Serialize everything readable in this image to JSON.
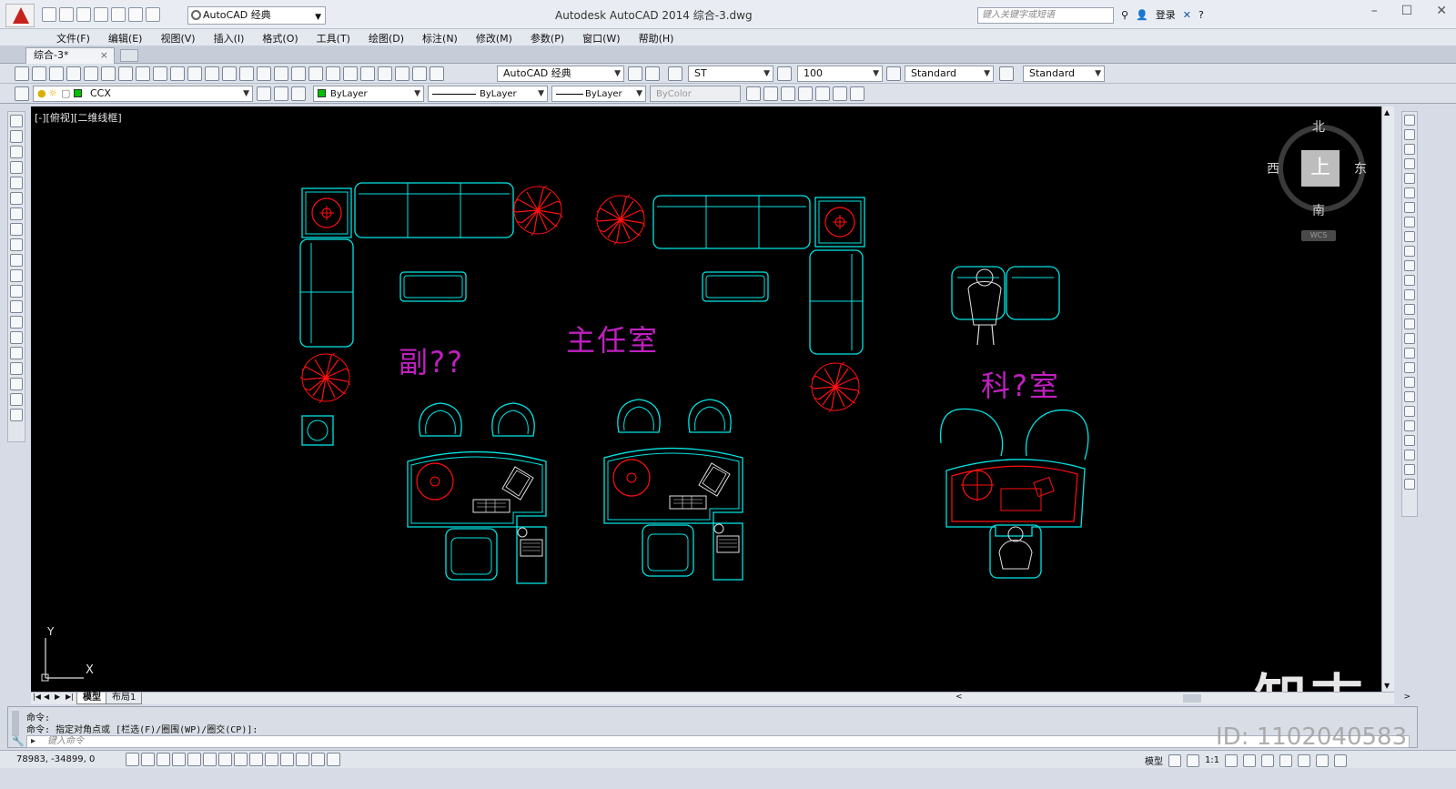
{
  "window": {
    "title": "Autodesk AutoCAD 2014      综合-3.dwg",
    "workspace": "AutoCAD 经典",
    "search_placeholder": "键入关键字或短语",
    "login": "登录"
  },
  "menu": [
    "文件(F)",
    "编辑(E)",
    "视图(V)",
    "插入(I)",
    "格式(O)",
    "工具(T)",
    "绘图(D)",
    "标注(N)",
    "修改(M)",
    "参数(P)",
    "窗口(W)",
    "帮助(H)"
  ],
  "doc_tab": "综合-3*",
  "toolbar1": {
    "workspace_combo": "AutoCAD 经典",
    "text_style": "ST",
    "dim_scale": "100",
    "dim_style": "Standard",
    "table_style": "Standard"
  },
  "toolbar2": {
    "layer": "CCX",
    "color": "ByLayer",
    "linetype": "ByLayer",
    "lineweight": "ByLayer",
    "plotstyle": "ByColor"
  },
  "canvas": {
    "view_label": "[-][俯视][二维线框]",
    "room_labels": [
      "主任室",
      "副??",
      "科?室"
    ],
    "viewcube": {
      "north": "北",
      "south": "南",
      "east": "东",
      "west": "西",
      "top": "上",
      "wcs": "WCS"
    },
    "ucs": {
      "x": "X",
      "y": "Y"
    },
    "colors": {
      "cyan": "#00e5e5",
      "red": "#ff1010",
      "magenta": "#c020c0"
    }
  },
  "layout_tabs": [
    "模型",
    "布局1"
  ],
  "command": {
    "line1": "命令:",
    "line2": "命令: 指定对角点或 [栏选(F)/圈围(WP)/圈交(CP)]:",
    "input_placeholder": "键入命令"
  },
  "status": {
    "coords": "78983, -34899, 0",
    "model": "模型",
    "scale": "1:1"
  },
  "watermark": {
    "logo": "知末",
    "id": "ID: 1102040583"
  }
}
